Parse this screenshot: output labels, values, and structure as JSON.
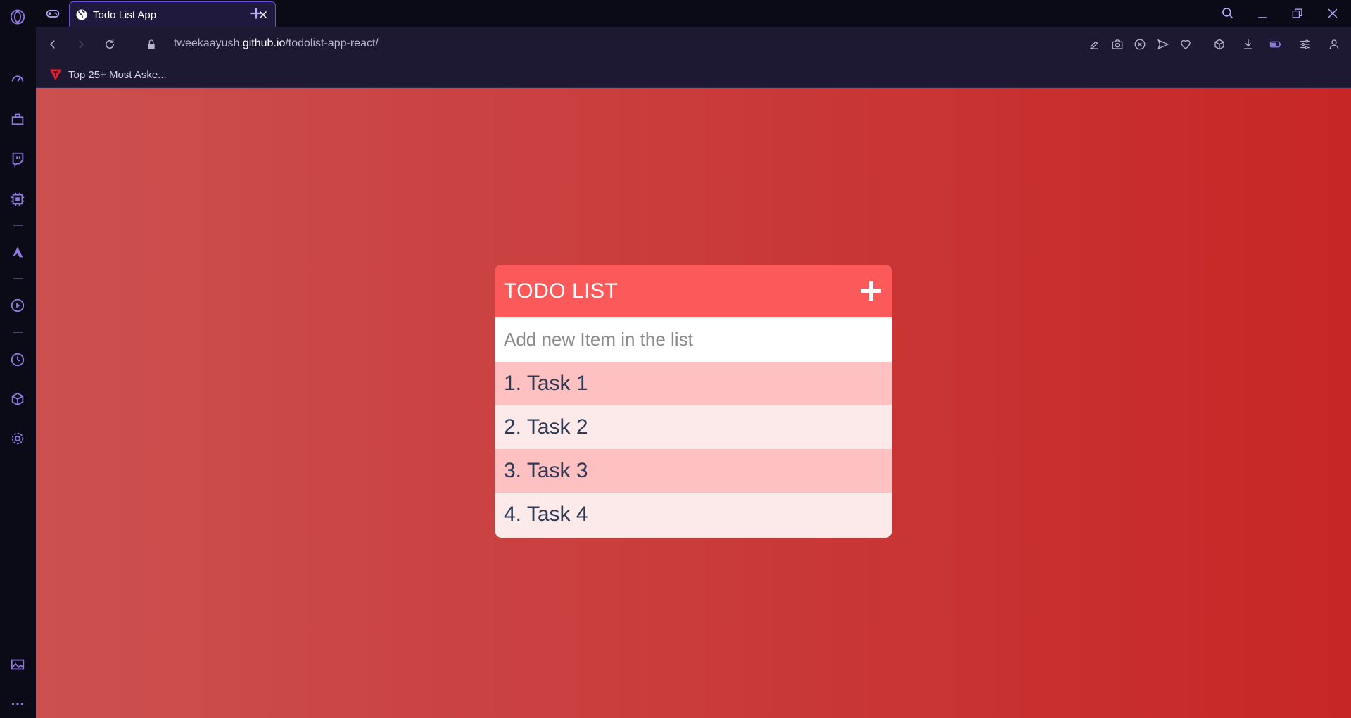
{
  "browser": {
    "tab": {
      "title": "Todo List App"
    },
    "address": {
      "host_prefix": "tweekaayush.",
      "host_domain": "github.io",
      "path": "/todolist-app-react/"
    },
    "bookmarks": [
      {
        "label": "Top 25+ Most Aske..."
      }
    ]
  },
  "sidebar": {
    "icons": [
      "opera-logo-icon",
      "speed-dial-icon",
      "extensions-icon",
      "twitch-icon",
      "cpu-icon",
      "aria-icon",
      "player-icon",
      "history-icon",
      "cube-icon",
      "settings-icon",
      "gallery-icon",
      "more-icon"
    ]
  },
  "todo": {
    "title": "TODO LIST",
    "input_placeholder": "Add new Item in the list",
    "items": [
      "1. Task 1",
      "2. Task 2",
      "3. Task 3",
      "4. Task 4"
    ]
  },
  "colors": {
    "accent": "#6b4fd8",
    "header": "#fc5a5a",
    "bg_left": "#cc5050",
    "bg_right": "#c72626",
    "task_odd": "#fec0c0",
    "task_even": "#fceaea",
    "task_text": "#2c3a57"
  }
}
